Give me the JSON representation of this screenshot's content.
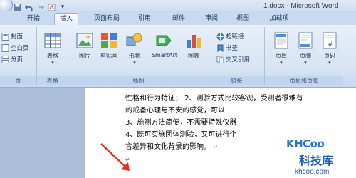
{
  "window": {
    "title": "1.docx - Microsoft Word"
  },
  "tabs": [
    {
      "label": "开始"
    },
    {
      "label": "插入",
      "active": true
    },
    {
      "label": "页面布局"
    },
    {
      "label": "引用"
    },
    {
      "label": "邮件"
    },
    {
      "label": "审阅"
    },
    {
      "label": "视图"
    },
    {
      "label": "加载项"
    }
  ],
  "ribbon": {
    "pages_group": {
      "label": "页",
      "items": [
        "封面",
        "空白页",
        "分页"
      ]
    },
    "table_group": {
      "label": "表格",
      "button": "表格"
    },
    "illustrations_group": {
      "label": "插图",
      "buttons": [
        "图片",
        "剪贴画",
        "形状",
        "SmartArt",
        "图表"
      ]
    },
    "links_group": {
      "label": "链接",
      "items": [
        "超链接",
        "书签",
        "交叉引用"
      ]
    },
    "header_footer_group": {
      "label": "页眉和页脚",
      "buttons": [
        "页眉",
        "页脚",
        "页码"
      ]
    }
  },
  "document": {
    "lines": [
      "性格和行为特征；    2、测验方式比较客观，受测者很难有",
      "的戒备心理与不安的感觉，可以",
      "3、施测方法简便，不需要特殊仪器",
      "4、既可实施团体测验，又可进行个",
      "言差异和文化背景的影响。"
    ],
    "para_mark": "↵"
  },
  "watermark": {
    "brand": "KHCoo",
    "cn": "科技库",
    "url": "khcoo.com"
  },
  "colors": {
    "ribbon_bg": "#dbe6f4",
    "tab_active": "#ffffff",
    "arrow": "#d9342b",
    "watermark": "#1d5fb0"
  }
}
